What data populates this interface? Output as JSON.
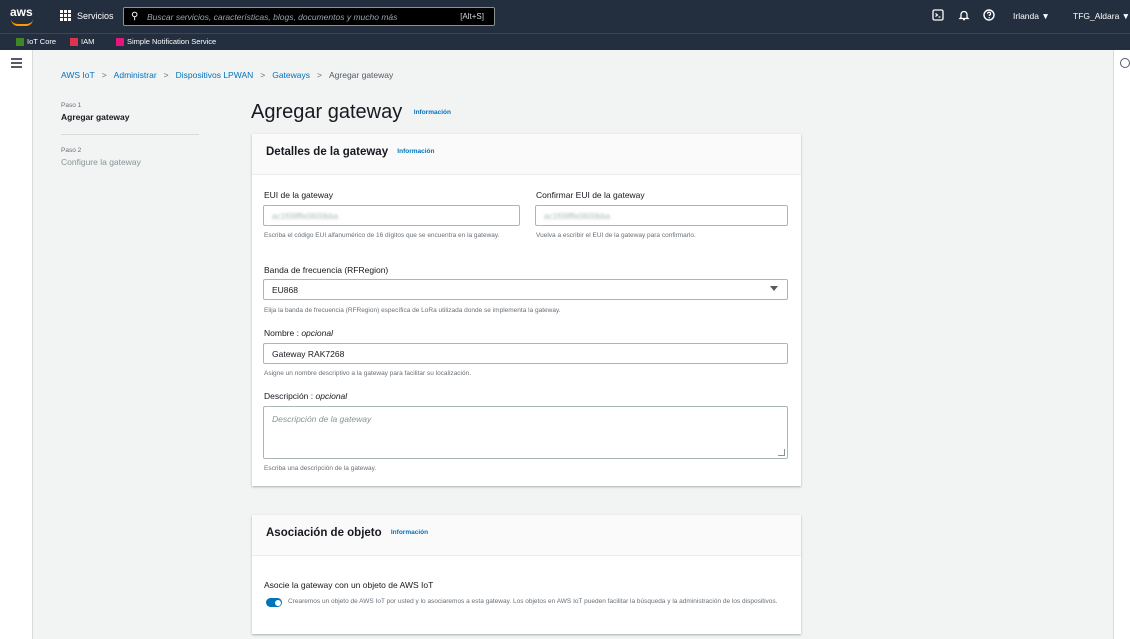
{
  "topbar": {
    "logo_text": "aws",
    "services_label": "Servicios",
    "search_placeholder": "Buscar servicios, características, blogs, documentos y mucho más",
    "search_shortcut": "[Alt+S]",
    "region": "Irlanda ▼",
    "account": "TFG_Aldara ▼"
  },
  "favorites": [
    {
      "label": "IoT Core",
      "color": "#3f8624"
    },
    {
      "label": "IAM",
      "color": "#dd344c"
    },
    {
      "label": "Simple Notification Service",
      "color": "#e7157b"
    }
  ],
  "breadcrumb": {
    "items": [
      "AWS IoT",
      "Administrar",
      "Dispositivos LPWAN",
      "Gateways"
    ],
    "current": "Agregar gateway",
    "separator": ">"
  },
  "steps": [
    {
      "label": "Paso 1",
      "title": "Agregar gateway"
    },
    {
      "label": "Paso 2",
      "title": "Configure la gateway"
    }
  ],
  "page": {
    "title": "Agregar gateway",
    "info_link": "Información"
  },
  "details": {
    "title": "Detalles de la gateway",
    "info_link": "Información",
    "eui_label": "EUI de la gateway",
    "eui_value": "ac1f09fffe0600bba",
    "eui_help": "Escriba el código EUI alfanumérico de 16 dígitos que se encuentra en la gateway.",
    "confirm_eui_label": "Confirmar EUI de la gateway",
    "confirm_eui_value": "ac1f09fffe0600bba",
    "confirm_eui_help": "Vuelva a escribir el EUI de la gateway para confirmarlo.",
    "rfregion_label": "Banda de frecuencia (RFRegion)",
    "rfregion_value": "EU868",
    "rfregion_help": "Elija la banda de frecuencia (RFRegion) específica de LoRa utilizada donde se implementa la gateway.",
    "name_label": "Nombre",
    "name_optional": "opcional",
    "name_value": "Gateway RAK7268",
    "name_help": "Asigne un nombre descriptivo a la gateway para facilitar su localización.",
    "desc_label": "Descripción",
    "desc_optional": "opcional",
    "desc_placeholder": "Descripción de la gateway",
    "desc_help": "Escriba una descripción de la gateway."
  },
  "association": {
    "title": "Asociación de objeto",
    "info_link": "Información",
    "toggle_label": "Asocie la gateway con un objeto de AWS IoT",
    "toggle_on": true,
    "toggle_desc": "Crearemos un objeto de AWS IoT por usted y lo asociaremos a esta gateway. Los objetos en AWS IoT pueden facilitar la búsqueda y la administración de los dispositivos."
  },
  "colors": {
    "topbar": "#232f3e",
    "link": "#0073bb",
    "brand_orange": "#ff9900"
  }
}
